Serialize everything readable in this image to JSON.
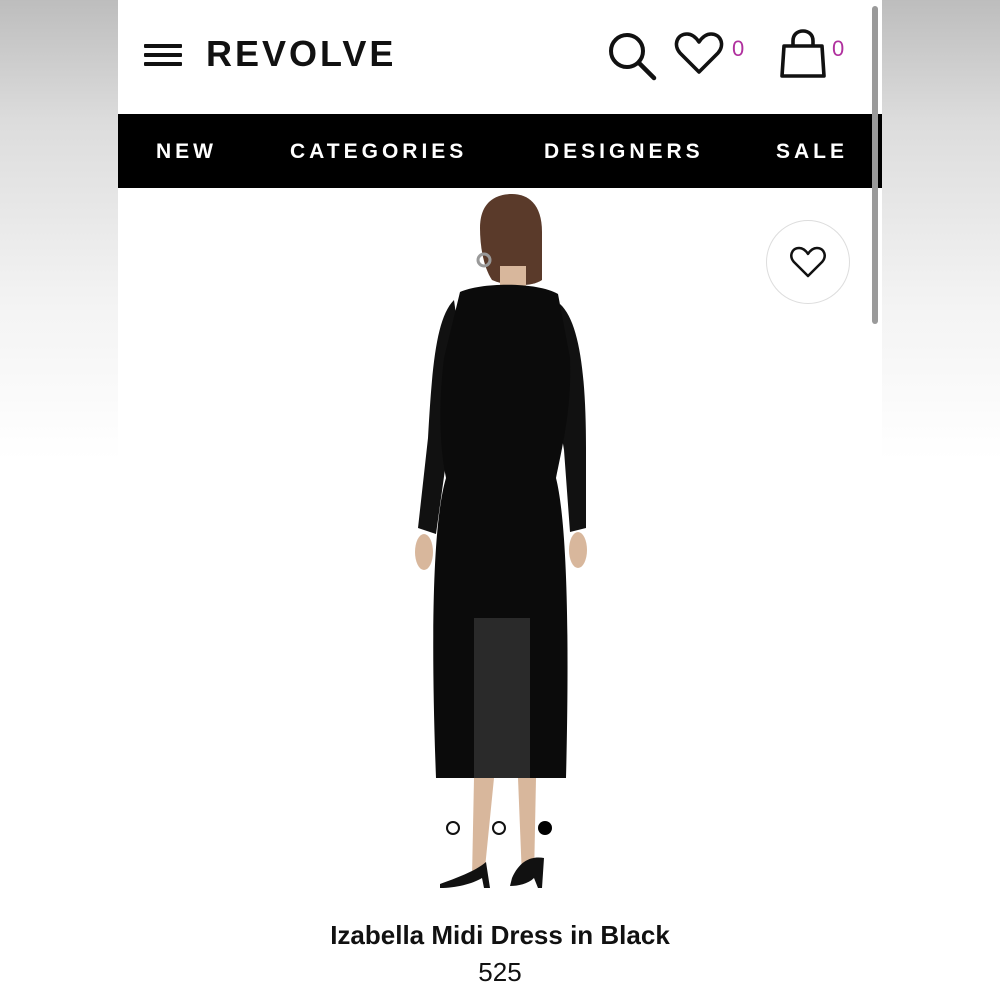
{
  "header": {
    "logo": "REVOLVE",
    "wishlist_count": "0",
    "bag_count": "0"
  },
  "nav": {
    "items": [
      "NEW",
      "CATEGORIES",
      "DESIGNERS",
      "SALE"
    ]
  },
  "product": {
    "title": "Izabella Midi Dress in Black",
    "price": "525",
    "image_carousel": {
      "total": 3,
      "active_index": 2
    }
  },
  "colors": {
    "accent_count": "#b0309e",
    "nav_bg": "#000000",
    "text": "#111111"
  },
  "icons": [
    "menu-icon",
    "search-icon",
    "heart-icon",
    "shopping-bag-icon",
    "favorite-heart-icon"
  ]
}
